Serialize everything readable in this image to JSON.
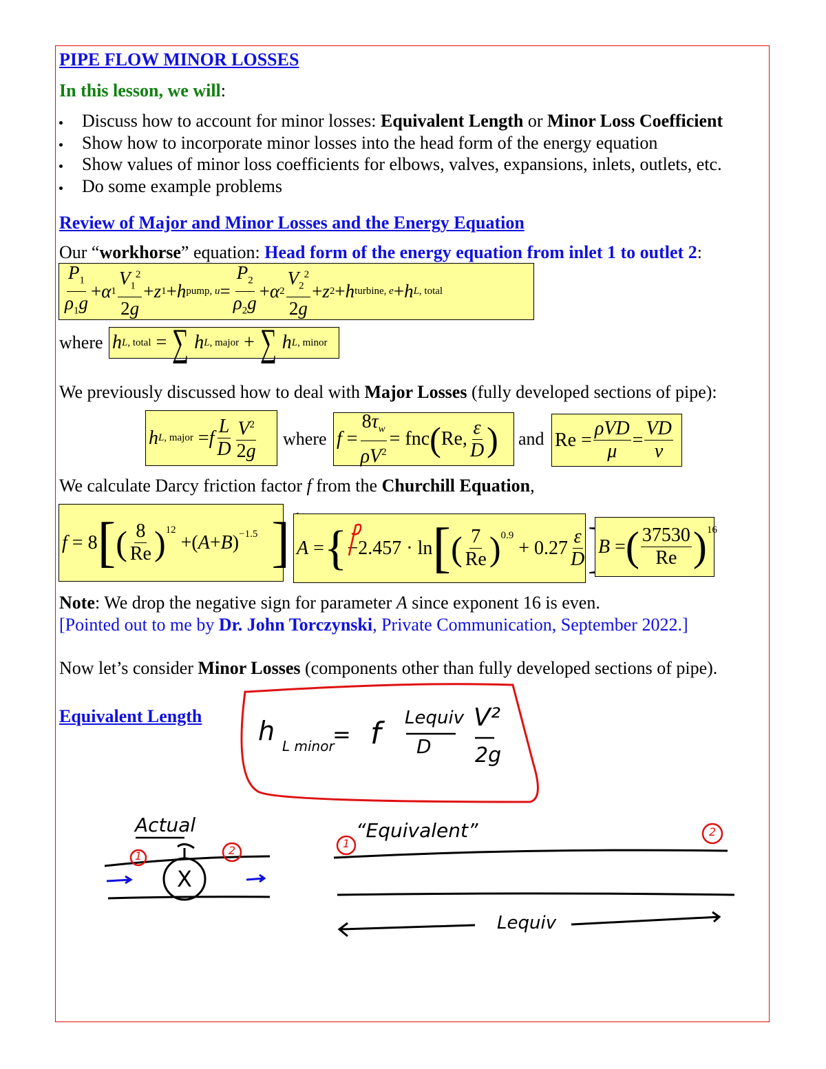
{
  "title": "PIPE FLOW MINOR LOSSES",
  "intro": "In this lesson, we will",
  "bullets": [
    {
      "pre": "Discuss how to account for minor losses: ",
      "b1": "Equivalent Length",
      "mid": " or ",
      "b2": "Minor Loss Coefficient"
    },
    {
      "pre": "Show how to incorporate minor losses into the head form of the energy equation"
    },
    {
      "pre": "Show values of minor loss coefficients for elbows, valves, expansions, inlets, outlets, etc."
    },
    {
      "pre": "Do some example problems"
    }
  ],
  "review_heading": "Review of Major and Minor Losses and the Energy Equation",
  "workhorse": {
    "pre": "Our “",
    "bold": "workhorse",
    "mid": "” equation: ",
    "blue": "Head form of the energy equation from inlet 1 to outlet 2",
    "post": ":"
  },
  "where": "where",
  "major_line": {
    "pre": "We previously discussed how to deal with ",
    "bold": "Major Losses",
    "post": " (fully developed sections of pipe):"
  },
  "and": "and",
  "churchill_line": {
    "pre": "We calculate Darcy friction factor ",
    "f": "f",
    "mid": " from the ",
    "bold": "Churchill Equation",
    "post": ","
  },
  "note": {
    "bold": "Note",
    "pre": ": We drop the negative sign for parameter ",
    "A": "A",
    "post": " since exponent 16 is even."
  },
  "credit": {
    "pre": "[Pointed out to me by ",
    "bold": "Dr. John Torczynski",
    "post": ", Private Communication, September 2022.]"
  },
  "minor_line": {
    "pre": "Now let’s consider ",
    "bold": "Minor Losses",
    "post": " (components other than fully developed sections of pipe)."
  },
  "equiv_heading": "Equivalent Length",
  "handwriting": {
    "formula_h": "h",
    "formula_sub": "L minor",
    "formula_eq": "=",
    "formula_f": "f",
    "formula_num": "Lequiv",
    "formula_den": "D",
    "formula_v": "V²",
    "formula_2g": "2g",
    "actual": "Actual",
    "equivalent": "“Equivalent”",
    "one": "1",
    "two": "2",
    "lequiv": "Lequiv",
    "valve_x": "X"
  },
  "colors": {
    "heading": "#1010e0",
    "green": "#108010",
    "box": "#ffff99",
    "frame": "#e01010",
    "ink_red": "#e01010",
    "ink_blue": "#1010e0"
  }
}
